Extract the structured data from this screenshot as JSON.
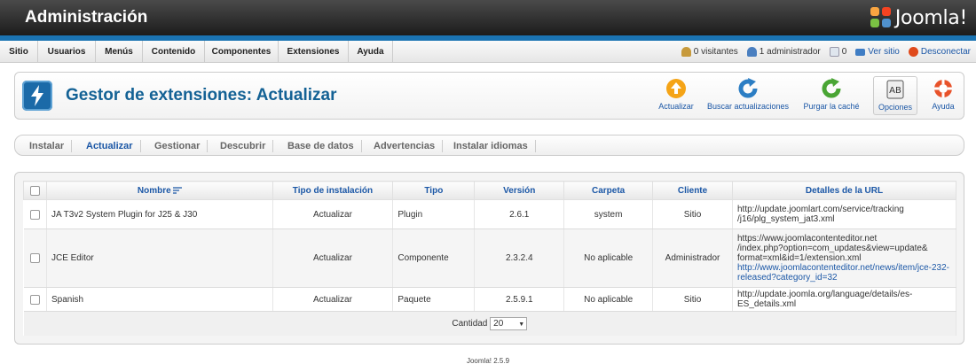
{
  "header": {
    "title": "Administración",
    "brand": "Joomla!"
  },
  "menu": {
    "items": [
      "Sitio",
      "Usuarios",
      "Menús",
      "Contenido",
      "Componentes",
      "Extensiones",
      "Ayuda"
    ]
  },
  "status": {
    "visitors": "0 visitantes",
    "admins": "1 administrador",
    "messages": "0",
    "view_site": "Ver sitio",
    "logout": "Desconectar"
  },
  "toolbar": {
    "title": "Gestor de extensiones: Actualizar",
    "buttons": {
      "update": "Actualizar",
      "find_updates": "Buscar actualizaciones",
      "purge_cache": "Purgar la caché",
      "options": "Opciones",
      "help": "Ayuda"
    }
  },
  "tabs": [
    "Instalar",
    "Actualizar",
    "Gestionar",
    "Descubrir",
    "Base de datos",
    "Advertencias",
    "Instalar idiomas"
  ],
  "active_tab": "Actualizar",
  "table": {
    "columns": [
      "Nombre",
      "Tipo de instalación",
      "Tipo",
      "Versión",
      "Carpeta",
      "Cliente",
      "Detalles de la URL"
    ],
    "rows": [
      {
        "name": "JA T3v2 System Plugin for J25 & J30",
        "install_type": "Actualizar",
        "type": "Plugin",
        "version": "2.6.1",
        "folder": "system",
        "client": "Sitio",
        "url_lines": [
          "http://update.joomlart.com/service/tracking",
          "/j16/plg_system_jat3.xml"
        ],
        "url_link": ""
      },
      {
        "name": "JCE Editor",
        "install_type": "Actualizar",
        "type": "Componente",
        "version": "2.3.2.4",
        "folder": "No aplicable",
        "client": "Administrador",
        "url_lines": [
          "https://www.joomlacontenteditor.net",
          "/index.php?option=com_updates&view=update&",
          "format=xml&id=1/extension.xml"
        ],
        "url_link": "http://www.joomlacontenteditor.net/news/item/jce-232-released?category_id=32"
      },
      {
        "name": "Spanish",
        "install_type": "Actualizar",
        "type": "Paquete",
        "version": "2.5.9.1",
        "folder": "No aplicable",
        "client": "Sitio",
        "url_lines": [
          "http://update.joomla.org/language/details/es-ES_details.xml"
        ],
        "url_link": ""
      }
    ],
    "footer": {
      "label": "Cantidad",
      "value": "20"
    }
  },
  "footer_text": "Joomla! 2.5.9",
  "colors": {
    "header_dark": "#1c1c1c",
    "accent_blue": "#1b74b3",
    "link_blue": "#1b57a6",
    "title_blue": "#146295"
  }
}
